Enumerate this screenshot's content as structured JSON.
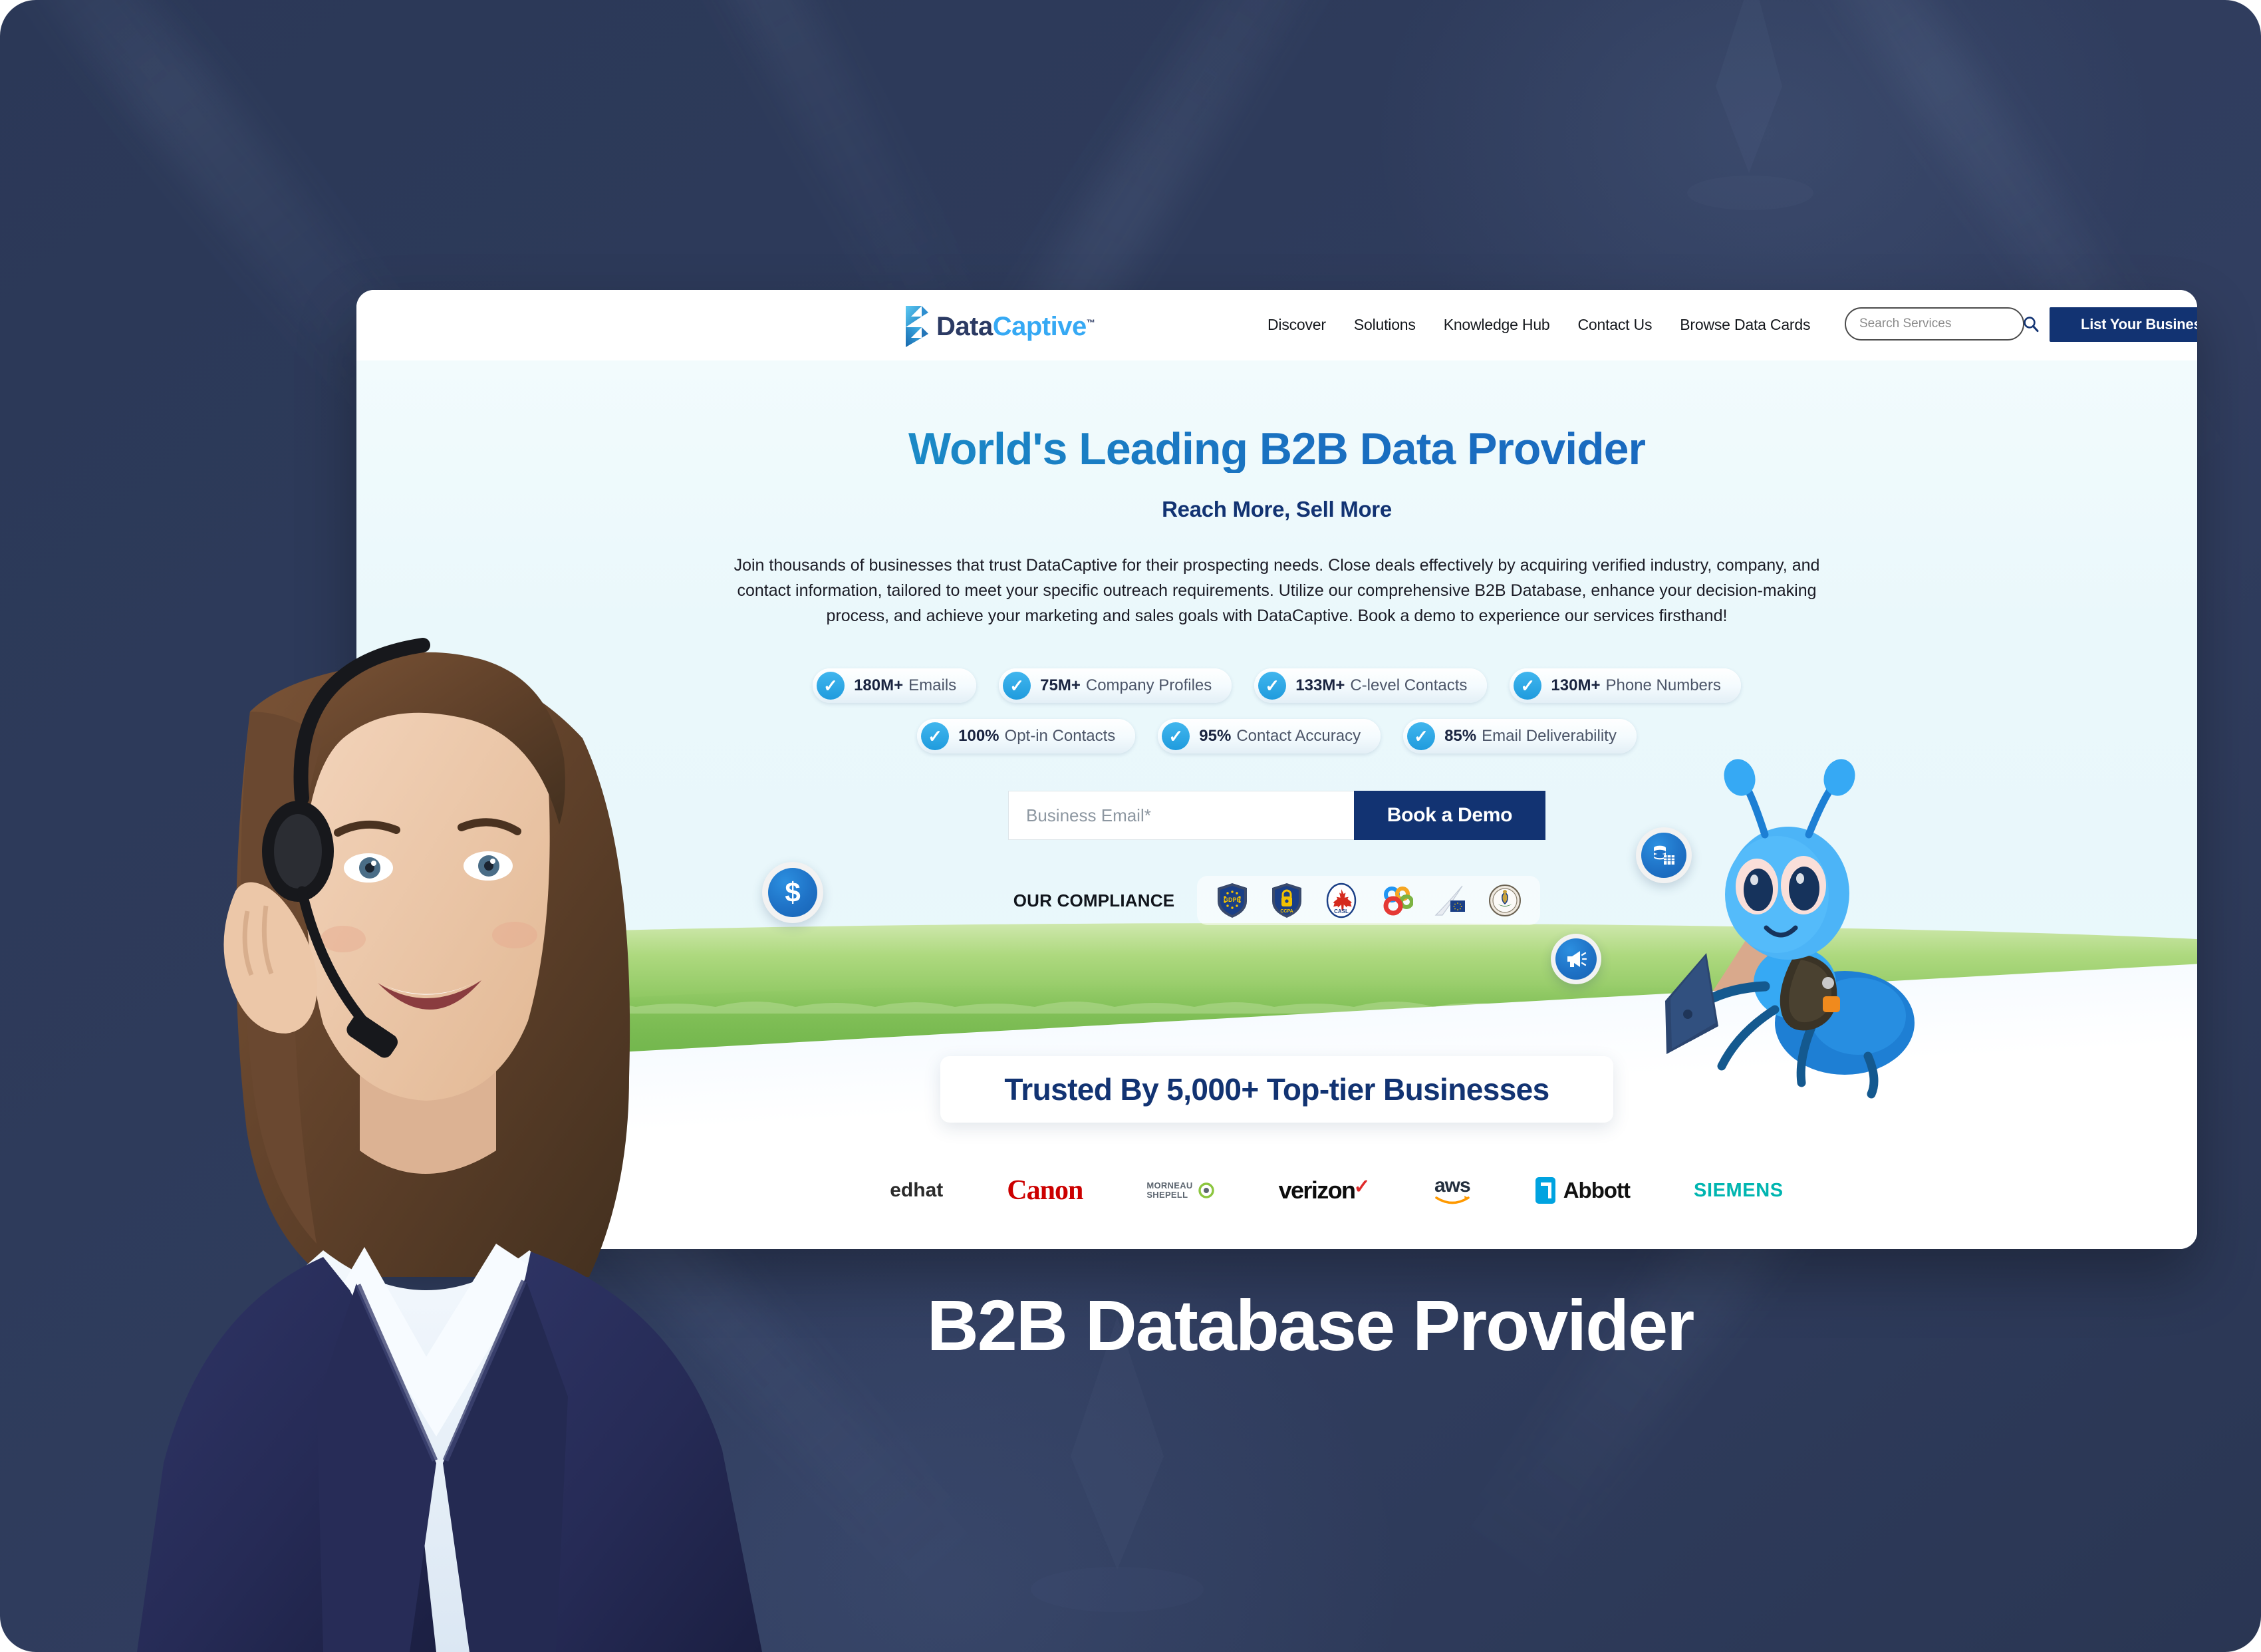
{
  "brand": {
    "name_dark": "Data",
    "name_light": "Captive",
    "tm": "™",
    "logo_icon": "datacaptive-ribbon-logo"
  },
  "nav": {
    "links": [
      {
        "label": "Discover"
      },
      {
        "label": "Solutions"
      },
      {
        "label": "Knowledge Hub"
      },
      {
        "label": "Contact Us"
      },
      {
        "label": "Browse Data Cards"
      }
    ],
    "search": {
      "placeholder": "Search Services",
      "value": "",
      "icon": "search-icon"
    },
    "cta_label": "List Your Business For Free"
  },
  "hero": {
    "heading": "World's Leading B2B Data Provider",
    "subheading": "Reach More, Sell More",
    "paragraph": "Join thousands of businesses that trust DataCaptive for their prospecting needs. Close deals effectively by acquiring verified industry, company, and contact information, tailored to meet your specific outreach requirements. Utilize our comprehensive B2B Database, enhance your decision-making process, and achieve your marketing and sales goals with DataCaptive. Book a demo to experience our services firsthand!",
    "stats_row1": [
      {
        "num": "180M+",
        "label": "Emails"
      },
      {
        "num": "75M+",
        "label": "Company Profiles"
      },
      {
        "num": "133M+",
        "label": "C-level Contacts"
      },
      {
        "num": "130M+",
        "label": "Phone Numbers"
      }
    ],
    "stats_row2": [
      {
        "num": "100%",
        "label": "Opt-in Contacts"
      },
      {
        "num": "95%",
        "label": "Contact Accuracy"
      },
      {
        "num": "85%",
        "label": "Email Deliverability"
      }
    ],
    "form": {
      "email_placeholder": "Business Email*",
      "email_value": "",
      "submit_label": "Book a Demo"
    },
    "compliance": {
      "label": "OUR COMPLIANCE",
      "badges": [
        {
          "name": "gdpr-shield-icon",
          "text": "GDPR"
        },
        {
          "name": "ccpa-shield-icon",
          "text": "CCPA"
        },
        {
          "name": "casl-canada-icon",
          "text": "CASL"
        },
        {
          "name": "privacy-rings-icon",
          "text": ""
        },
        {
          "name": "eu-flag-quill-icon",
          "text": ""
        },
        {
          "name": "us-seal-icon",
          "text": ""
        }
      ]
    },
    "floating_icons": [
      {
        "name": "dollar-badge-icon",
        "glyph": "$"
      },
      {
        "name": "database-badge-icon",
        "glyph": ""
      },
      {
        "name": "megaphone-badge-icon",
        "glyph": ""
      }
    ],
    "mascot": "blue-ant-mascot-with-laptop"
  },
  "trusted": {
    "text": "Trusted By 5,000+ Top-tier Businesses"
  },
  "clients": [
    {
      "name": "redhat-logo",
      "label": "edhat"
    },
    {
      "name": "canon-logo",
      "label": "Canon"
    },
    {
      "name": "morneau-shepell-logo",
      "label": "MORNEAU SHEPELL"
    },
    {
      "name": "verizon-logo",
      "label": "verizon"
    },
    {
      "name": "aws-logo",
      "label": "aws"
    },
    {
      "name": "abbott-logo",
      "label": "Abbott"
    },
    {
      "name": "siemens-logo",
      "label": "SIEMENS"
    }
  ],
  "bottom_title": "B2B Database Provider",
  "colors": {
    "navy": "#123372",
    "accent_blue": "#1f8fd8",
    "cyan": "#19a2c6",
    "backdrop": "#2e3b5b",
    "canon_red": "#cc0000",
    "siemens_teal": "#00b5b0"
  }
}
